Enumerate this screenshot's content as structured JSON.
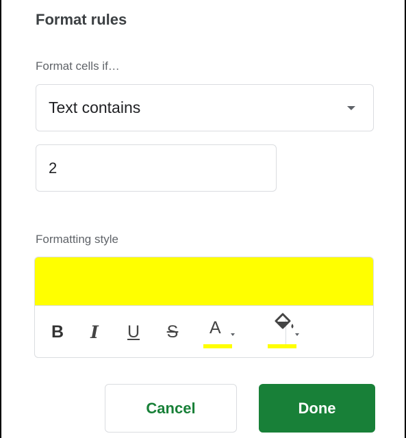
{
  "panel": {
    "title": "Format rules",
    "condition_label": "Format cells if…",
    "condition_value": "Text contains",
    "value_input": "2",
    "style_label": "Formatting style"
  },
  "style": {
    "fill_color": "#ffff00",
    "text_color_indicator": "#ffff00",
    "fill_color_indicator": "#ffff00",
    "toolbar": {
      "bold": "B",
      "italic": "I",
      "underline": "U",
      "strikethrough": "S",
      "text_color": "A"
    }
  },
  "buttons": {
    "cancel": "Cancel",
    "done": "Done"
  },
  "colors": {
    "accent": "#188038",
    "border": "#dadce0"
  }
}
